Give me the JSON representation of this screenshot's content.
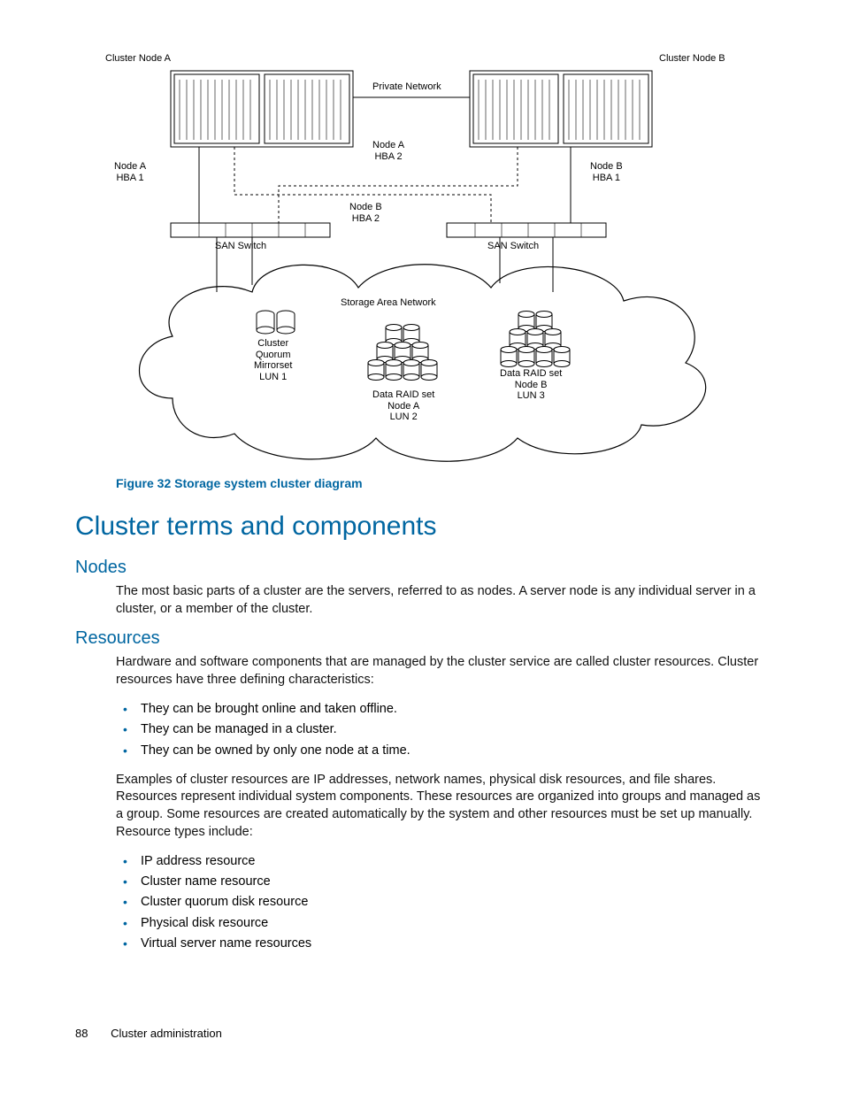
{
  "figure": {
    "caption": "Figure 32 Storage system cluster diagram",
    "labels": {
      "cluster_node_a": "Cluster Node A",
      "cluster_node_b": "Cluster Node B",
      "private_network": "Private Network",
      "node_a_hba1": "Node A\nHBA 1",
      "node_a_hba2": "Node A\nHBA 2",
      "node_b_hba1": "Node B\nHBA 1",
      "node_b_hba2": "Node B\nHBA 2",
      "san_switch_l": "SAN Switch",
      "san_switch_r": "SAN Switch",
      "san": "Storage Area Network",
      "quorum": "Cluster\nQuorum\nMirrorset\nLUN 1",
      "raid_a": "Data RAID set\nNode A\nLUN 2",
      "raid_b": "Data RAID set\nNode B\nLUN 3"
    }
  },
  "headings": {
    "h1": "Cluster terms and components",
    "h2_nodes": "Nodes",
    "h2_resources": "Resources"
  },
  "paragraphs": {
    "nodes": "The most basic parts of a cluster are the servers, referred to as nodes. A server node is any individual server in a cluster, or a member of the cluster.",
    "resources_intro": "Hardware and software components that are managed by the cluster service are called cluster resources. Cluster resources have three defining characteristics:",
    "resources_examples": "Examples of cluster resources are IP addresses, network names, physical disk resources, and file shares. Resources represent individual system components. These resources are organized into groups and managed as a group. Some resources are created automatically by the system and other resources must be set up manually. Resource types include:"
  },
  "lists": {
    "characteristics": [
      "They can be brought online and taken offline.",
      "They can be managed in a cluster.",
      "They can be owned by only one node at a time."
    ],
    "resource_types": [
      "IP address resource",
      "Cluster name resource",
      "Cluster quorum disk resource",
      "Physical disk resource",
      "Virtual server name resources"
    ]
  },
  "footer": {
    "page_number": "88",
    "section": "Cluster administration"
  }
}
